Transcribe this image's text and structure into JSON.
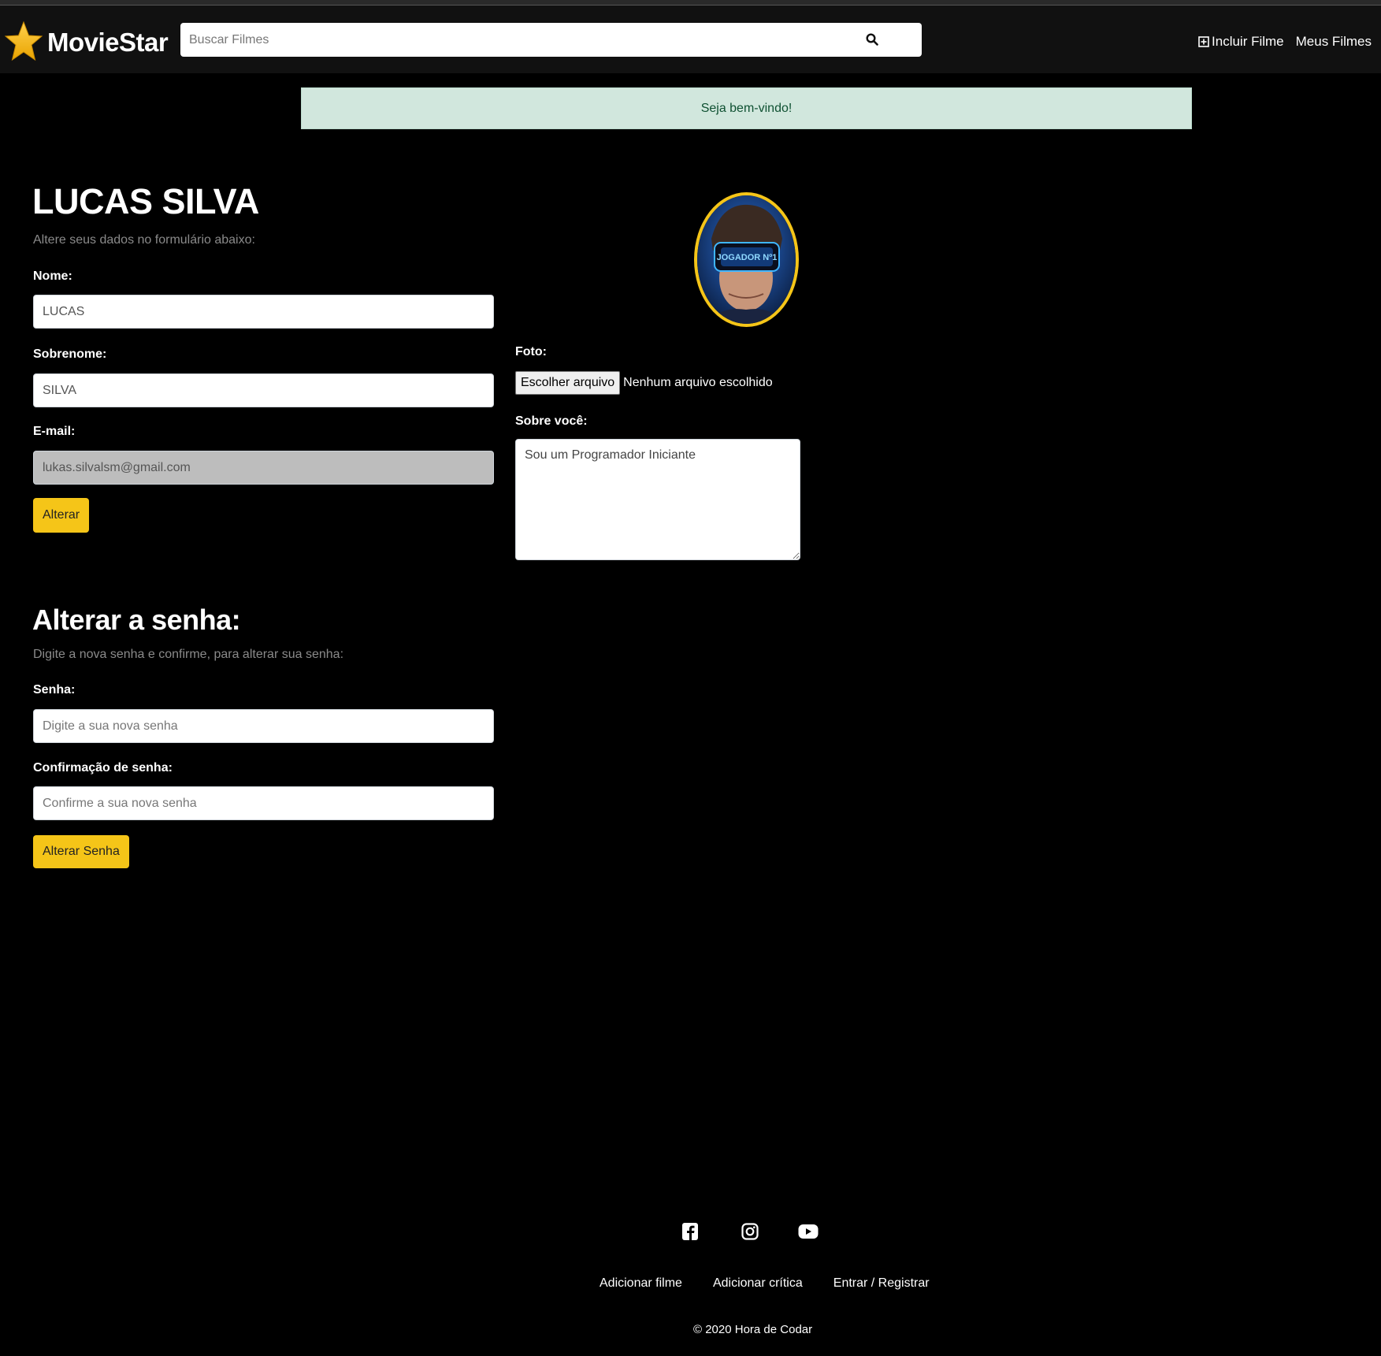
{
  "navbar": {
    "brand": "MovieStar",
    "search_placeholder": "Buscar Filmes",
    "links": [
      "Incluir Filme",
      "Meus Filmes"
    ]
  },
  "alert": {
    "message": "Seja bem-vindo!"
  },
  "profile": {
    "title": "LUCAS SILVA",
    "subtitle": "Altere seus dados no formulário abaixo:",
    "name_label": "Nome:",
    "name_value": "LUCAS",
    "lastname_label": "Sobrenome:",
    "lastname_value": "SILVA",
    "email_label": "E-mail:",
    "email_value": "lukas.silvalsm@gmail.com",
    "submit_label": "Alterar",
    "photo_label": "Foto:",
    "file_button": "Escolher arquivo",
    "file_status": "Nenhum arquivo escolhido",
    "about_label": "Sobre você:",
    "about_value": "Sou um Programador Iniciante",
    "avatar_text": "JOGADOR Nº1"
  },
  "password": {
    "title": "Alterar a senha:",
    "subtitle": "Digite a nova senha e confirme, para alterar sua senha:",
    "password_label": "Senha:",
    "password_placeholder": "Digite a sua nova senha",
    "confirm_label": "Confirmação de senha:",
    "confirm_placeholder": "Confirme a sua nova senha",
    "submit_label": "Alterar Senha"
  },
  "footer": {
    "social_icons": [
      "facebook-icon",
      "instagram-icon",
      "youtube-icon"
    ],
    "links": [
      "Adicionar filme",
      "Adicionar crítica",
      "Entrar / Registrar"
    ],
    "copyright": "© 2020 Hora de Codar"
  },
  "colors": {
    "accent": "#f5c518",
    "alert_bg": "#d1e7dd",
    "alert_text": "#0f5132",
    "navbar_bg": "#111111",
    "page_bg": "#000000"
  }
}
